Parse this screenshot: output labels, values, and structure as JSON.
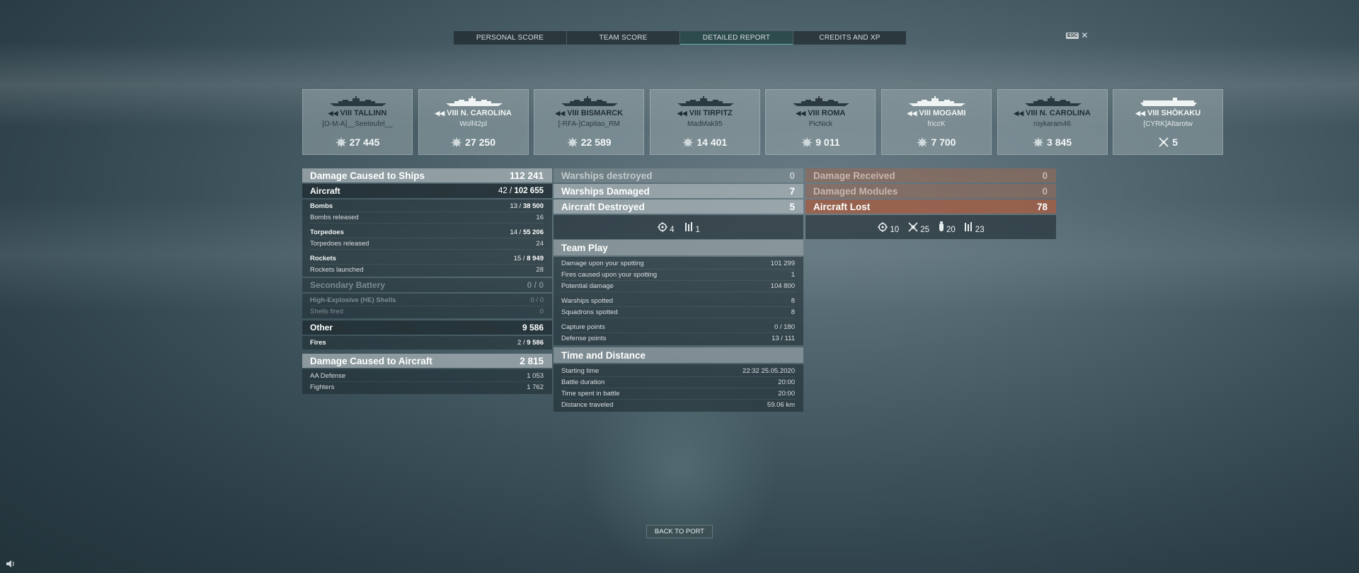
{
  "tabs": [
    {
      "label": "PERSONAL SCORE",
      "active": false
    },
    {
      "label": "TEAM SCORE",
      "active": false
    },
    {
      "label": "DETAILED REPORT",
      "active": true
    },
    {
      "label": "CREDITS AND XP",
      "active": false
    }
  ],
  "esc": {
    "key": "ESC",
    "close": "✕"
  },
  "ships": [
    {
      "tier": "VIII",
      "name": "TALLINN",
      "player": "[O-M-A]__Seeteufel__",
      "score": "27 445",
      "score_icon": "damage-icon"
    },
    {
      "tier": "VIII",
      "name": "N. CAROLINA",
      "player": "Wolf42pl",
      "score": "27 250",
      "score_icon": "damage-icon"
    },
    {
      "tier": "VIII",
      "name": "BISMARCK",
      "player": "[-RFA-]Capitao_RM",
      "score": "22 589",
      "score_icon": "damage-icon"
    },
    {
      "tier": "VIII",
      "name": "TIRPITZ",
      "player": "MadMak95",
      "score": "14 401",
      "score_icon": "damage-icon"
    },
    {
      "tier": "VIII",
      "name": "ROMA",
      "player": "PicNick",
      "score": "9 011",
      "score_icon": "damage-icon"
    },
    {
      "tier": "VIII",
      "name": "MOGAMI",
      "player": "friccK",
      "score": "7 700",
      "score_icon": "damage-icon"
    },
    {
      "tier": "VIII",
      "name": "N. CAROLINA",
      "player": "roykaram46",
      "score": "3 845",
      "score_icon": "damage-icon"
    },
    {
      "tier": "VIII",
      "name": "SHŌKAKU",
      "player": "[CYRK]Altarotw",
      "score": "5",
      "score_icon": "planes-destroyed-icon"
    }
  ],
  "damage_ships": {
    "title": "Damage Caused to Ships",
    "total": "112 241",
    "aircraft": {
      "label": "Aircraft",
      "hits": "42 / ",
      "value": "102 655"
    },
    "bombs": {
      "label": "Bombs",
      "hits": "13 / ",
      "value": "38 500",
      "released_label": "Bombs released",
      "released": "16"
    },
    "torpedoes": {
      "label": "Torpedoes",
      "hits": "14 / ",
      "value": "55 206",
      "released_label": "Torpedoes released",
      "released": "24"
    },
    "rockets": {
      "label": "Rockets",
      "hits": "15 / ",
      "value": "8 949",
      "released_label": "Rockets launched",
      "released": "28"
    },
    "secondary": {
      "label": "Secondary Battery",
      "value": "0 / 0",
      "he_label": "High-Explosive (HE) Shells",
      "he_value": "0 / 0",
      "fired_label": "Shells fired",
      "fired": "0"
    },
    "other": {
      "label": "Other",
      "value": "9 586",
      "fires_label": "Fires",
      "fires_hits": "2 / ",
      "fires_value": "9 586"
    }
  },
  "damage_aircraft": {
    "title": "Damage Caused to Aircraft",
    "total": "2 815",
    "aa_label": "AA Defense",
    "aa_value": "1 053",
    "fighters_label": "Fighters",
    "fighters_value": "1 762"
  },
  "middle": {
    "destroyed_label": "Warships destroyed",
    "destroyed": "0",
    "damaged_label": "Warships Damaged",
    "damaged": "7",
    "aircraft_destroyed_label": "Aircraft Destroyed",
    "aircraft_destroyed": "5",
    "ad_icons": [
      {
        "icon": "target-icon",
        "value": "4"
      },
      {
        "icon": "planes-icon",
        "value": "1"
      }
    ]
  },
  "team_play": {
    "title": "Team Play",
    "rows": [
      {
        "label": "Damage upon your spotting",
        "value": "101 299"
      },
      {
        "label": "Fires caused upon your spotting",
        "value": "1"
      },
      {
        "label": "Potential damage",
        "value": "104 800"
      }
    ],
    "rows2": [
      {
        "label": "Warships spotted",
        "value": "8"
      },
      {
        "label": "Squadrons spotted",
        "value": "8"
      }
    ],
    "rows3": [
      {
        "label": "Capture points",
        "value": "0 / 180"
      },
      {
        "label": "Defense points",
        "value": "13 / 111"
      }
    ]
  },
  "time_distance": {
    "title": "Time and Distance",
    "rows": [
      {
        "label": "Starting time",
        "value": "22:32  25.05.2020"
      },
      {
        "label": "Battle duration",
        "value": "20:00"
      },
      {
        "label": "Time spent in battle",
        "value": "20:00"
      },
      {
        "label": "Distance traveled",
        "value": "59.06 km"
      }
    ]
  },
  "received": {
    "damage_label": "Damage Received",
    "damage": "0",
    "modules_label": "Damaged Modules",
    "modules": "0",
    "aircraft_lost_label": "Aircraft Lost",
    "aircraft_lost": "78",
    "icons": [
      {
        "icon": "target-icon",
        "value": "10"
      },
      {
        "icon": "crossed-plane-icon",
        "value": "25"
      },
      {
        "icon": "bomb-icon",
        "value": "20"
      },
      {
        "icon": "planes-icon",
        "value": "23"
      }
    ]
  },
  "back_button": "BACK TO PORT"
}
